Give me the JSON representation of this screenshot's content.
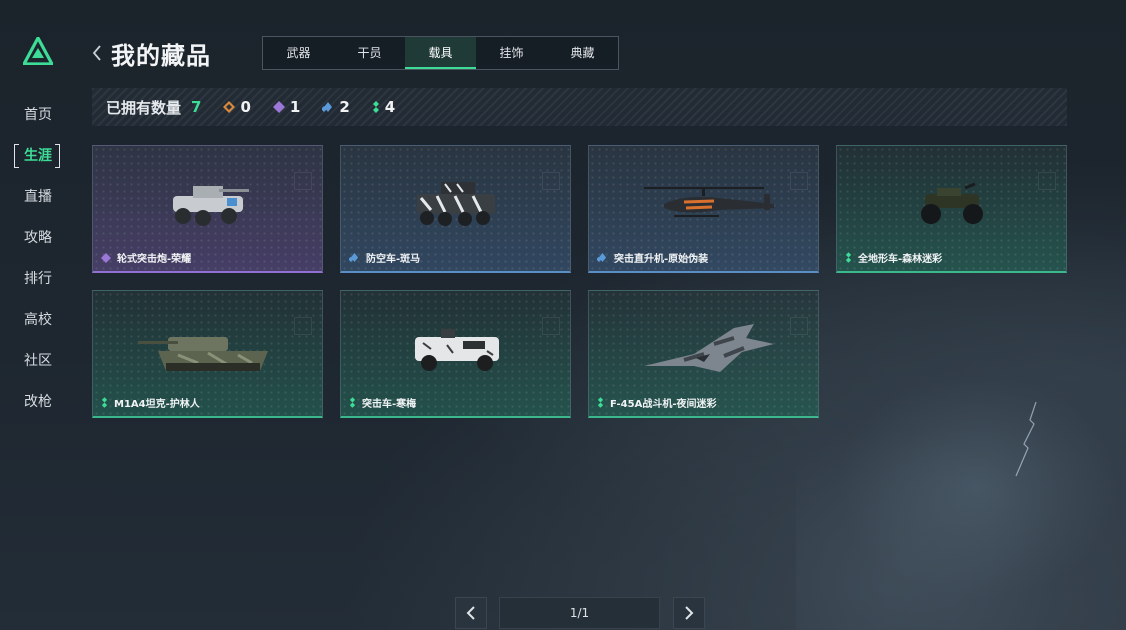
{
  "sidebar": {
    "items": [
      {
        "label": "首页"
      },
      {
        "label": "生涯"
      },
      {
        "label": "直播"
      },
      {
        "label": "攻略"
      },
      {
        "label": "排行"
      },
      {
        "label": "高校"
      },
      {
        "label": "社区"
      },
      {
        "label": "改枪"
      }
    ],
    "active_index": 1
  },
  "header": {
    "title": "我的藏品",
    "tabs": [
      {
        "label": "武器"
      },
      {
        "label": "干员"
      },
      {
        "label": "载具"
      },
      {
        "label": "挂饰"
      },
      {
        "label": "典藏"
      }
    ],
    "active_tab": 2
  },
  "stats": {
    "label": "已拥有数量",
    "total": "7",
    "rarities": [
      {
        "icon": "orange-diamond-icon",
        "color": "#d98a3e",
        "count": "0"
      },
      {
        "icon": "purple-diamond-icon",
        "color": "#9b78d8",
        "count": "1"
      },
      {
        "icon": "blue-diamond-icon",
        "color": "#5a9ad8",
        "count": "2"
      },
      {
        "icon": "green-diamond-icon",
        "color": "#3ddc97",
        "count": "4"
      }
    ]
  },
  "cards": [
    {
      "name": "轮式突击炮-荣耀",
      "rarity": "purple"
    },
    {
      "name": "防空车-斑马",
      "rarity": "blue"
    },
    {
      "name": "突击直升机-原始伪装",
      "rarity": "blue"
    },
    {
      "name": "全地形车-森林迷彩",
      "rarity": "green"
    },
    {
      "name": "M1A4坦克-护林人",
      "rarity": "green"
    },
    {
      "name": "突击车-寒梅",
      "rarity": "green"
    },
    {
      "name": "F-45A战斗机-夜间迷彩",
      "rarity": "green"
    }
  ],
  "pager": {
    "page": "1/1"
  },
  "colors": {
    "accent": "#3ddc97",
    "purple": "#9070d0",
    "blue": "#5a8ec4",
    "green": "#3cb98c"
  }
}
